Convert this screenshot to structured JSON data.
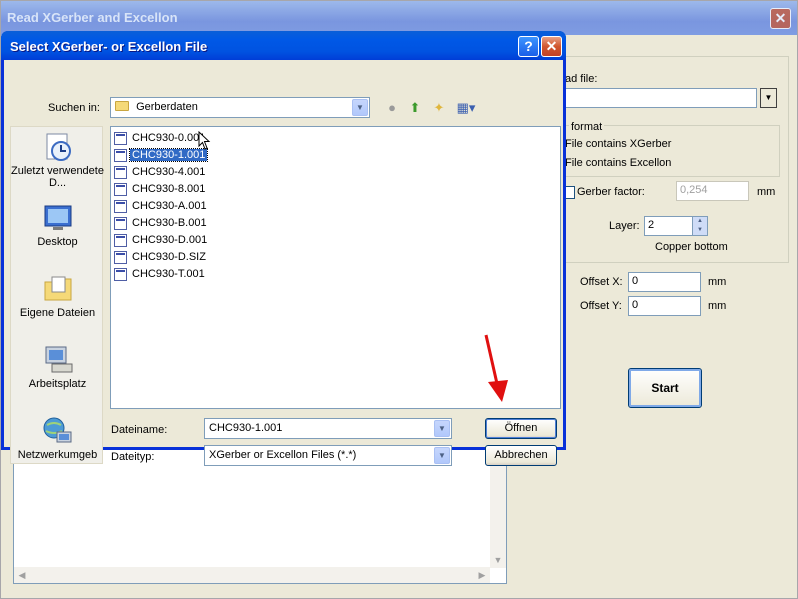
{
  "background_window": {
    "title": "Read XGerber and Excellon",
    "close_glyph": "✕",
    "read_file_label": "ad file:",
    "format_group_label": "format",
    "radio_xgerber": "File contains XGerber",
    "radio_excellon": "File contains Excellon",
    "gerber_factor_label": "Gerber factor:",
    "gerber_factor_value": "0,254",
    "mm_unit": "mm",
    "layer_label": "Layer:",
    "layer_value": "2",
    "layer_name": "Copper bottom",
    "offset_x_label": "Offset X:",
    "offset_x_value": "0",
    "offset_y_label": "Offset Y:",
    "offset_y_value": "0",
    "start_label": "Start"
  },
  "dialog": {
    "title": "Select XGerber- or Excellon File",
    "help_glyph": "?",
    "close_glyph": "✕",
    "look_in_label": "Suchen in:",
    "look_in_value": "Gerberdaten",
    "places": [
      {
        "label": "Zuletzt verwendete D...",
        "icon": "recent-icon"
      },
      {
        "label": "Desktop",
        "icon": "desktop-icon"
      },
      {
        "label": "Eigene Dateien",
        "icon": "my-documents-icon"
      },
      {
        "label": "Arbeitsplatz",
        "icon": "my-computer-icon"
      },
      {
        "label": "Netzwerkumgeb",
        "icon": "network-icon"
      }
    ],
    "files": [
      "CHC930-0.001",
      "CHC930-1.001",
      "CHC930-4.001",
      "CHC930-8.001",
      "CHC930-A.001",
      "CHC930-B.001",
      "CHC930-D.001",
      "CHC930-D.SIZ",
      "CHC930-T.001"
    ],
    "selected_file": "CHC930-1.001",
    "filename_label": "Dateiname:",
    "filename_value": "CHC930-1.001",
    "filetype_label": "Dateityp:",
    "filetype_value": "XGerber or Excellon Files (*.*)",
    "open_label": "Öffnen",
    "cancel_label": "Abbrechen"
  },
  "colors": {
    "annotation_arrow": "#e01010",
    "selection": "#316ac5",
    "title_blue": "#0054e3"
  }
}
